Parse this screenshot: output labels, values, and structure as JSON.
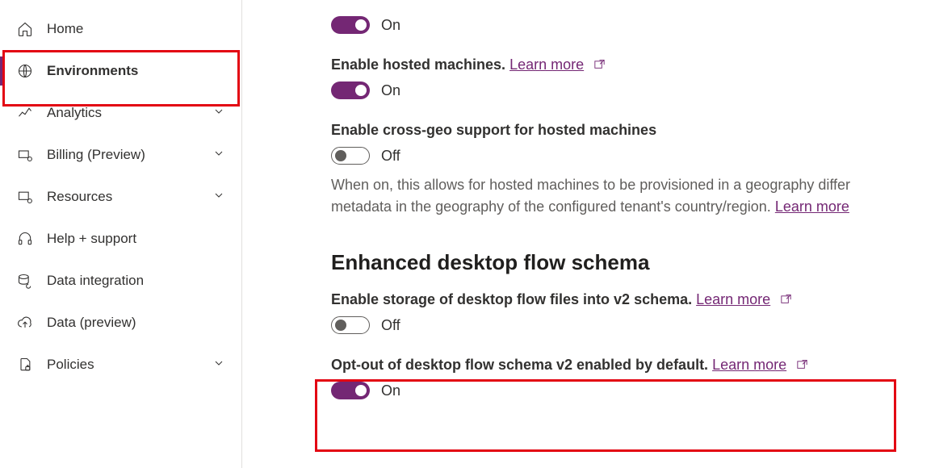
{
  "sidebar": {
    "items": [
      {
        "label": "Home"
      },
      {
        "label": "Environments"
      },
      {
        "label": "Analytics"
      },
      {
        "label": "Billing (Preview)"
      },
      {
        "label": "Resources"
      },
      {
        "label": "Help + support"
      },
      {
        "label": "Data integration"
      },
      {
        "label": "Data (preview)"
      },
      {
        "label": "Policies"
      }
    ]
  },
  "labels": {
    "on": "On",
    "off": "Off",
    "learn_more": "Learn more"
  },
  "settings": {
    "s1_state": "On",
    "s2_title": "Enable hosted machines.",
    "s2_state": "On",
    "s3_title": "Enable cross-geo support for hosted machines",
    "s3_state": "Off",
    "s3_desc_a": "When on, this allows for hosted machines to be provisioned in a geography differ",
    "s3_desc_b": "metadata in the geography of the configured tenant's country/region.",
    "section_heading": "Enhanced desktop flow schema",
    "s4_title": "Enable storage of desktop flow files into v2 schema.",
    "s4_state": "Off",
    "s5_title": "Opt-out of desktop flow schema v2 enabled by default.",
    "s5_state": "On"
  }
}
